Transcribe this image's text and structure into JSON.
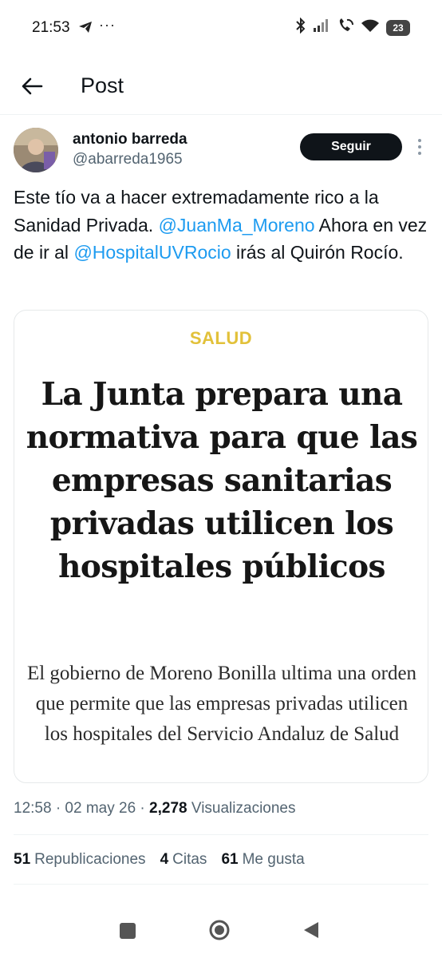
{
  "status_bar": {
    "time": "21:53",
    "dots": "···",
    "battery": "23",
    "icons": [
      "telegram-icon",
      "bluetooth-icon",
      "signal-icon",
      "wifi-call-icon",
      "wifi-icon",
      "battery-icon"
    ]
  },
  "header": {
    "title": "Post",
    "back_icon": "arrow-left-icon"
  },
  "author": {
    "name": "antonio barreda",
    "handle": "@abarreda1965",
    "follow_label": "Seguir"
  },
  "tweet": {
    "text_1": "Este tío va a hacer extremadamente rico a la Sanidad Privada. ",
    "mention_1": "@JuanMa_Moreno",
    "text_2": " Ahora en vez de ir al ",
    "mention_2": "@HospitalUVRocio",
    "text_3": " irás al Quirón Rocío."
  },
  "media": {
    "section": "SALUD",
    "headline": "La Junta prepara una normativa para que las empresas sanitarias privadas utilicen los hospitales públicos",
    "subheadline": "El gobierno de Moreno Bonilla ultima una orden que permite que las empresas privadas utilicen los hospitales del Servicio Andaluz de Salud"
  },
  "meta": {
    "time_date": "12:58 · 02 may 26 · ",
    "views_count": "2,278",
    "views_label": " Visualizaciones"
  },
  "stats": {
    "reposts_count": "51",
    "reposts_label": "Republicaciones",
    "quotes_count": "4",
    "quotes_label": "Citas",
    "likes_count": "61",
    "likes_label": "Me gusta"
  },
  "colors": {
    "link": "#1d9bf0",
    "secondary_text": "#536471",
    "section_label": "#e2c13a",
    "button_bg": "#0f1419"
  }
}
